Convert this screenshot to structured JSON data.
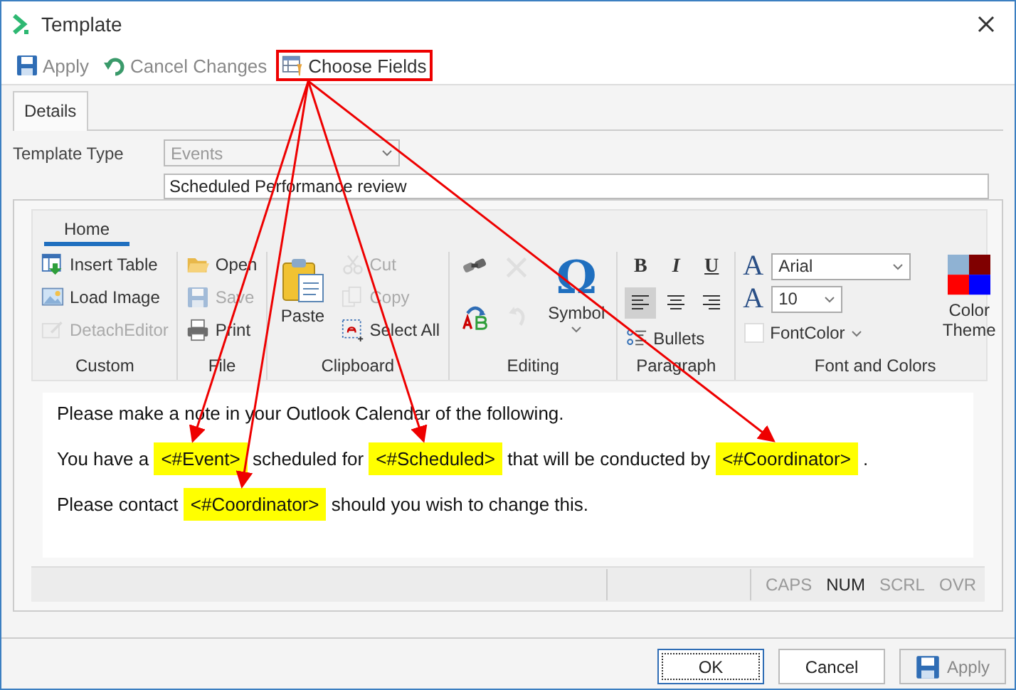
{
  "window": {
    "title": "Template"
  },
  "toolbar": [
    {
      "kind": "save",
      "label": "Apply",
      "disabled": true,
      "highlighted": false
    },
    {
      "kind": "undo",
      "label": "Cancel Changes",
      "disabled": true,
      "highlighted": false
    },
    {
      "kind": "fields",
      "label": "Choose Fields",
      "disabled": false,
      "highlighted": true
    }
  ],
  "tabs": [
    {
      "label": "Details",
      "selected": true
    }
  ],
  "form": {
    "template_type": {
      "label": "Template Type",
      "value": "Events",
      "disabled": true
    },
    "name": {
      "value": "Scheduled Performance review"
    }
  },
  "ribbon": {
    "tabs": [
      {
        "label": "Home",
        "selected": true
      }
    ],
    "groups": [
      {
        "label": "Custom",
        "items": [
          {
            "kind": "insert-table",
            "label": "Insert Table",
            "disabled": false
          },
          {
            "kind": "load-image",
            "label": "Load Image",
            "disabled": false
          },
          {
            "kind": "detach",
            "label": "DetachEditor",
            "disabled": true
          }
        ]
      },
      {
        "label": "File",
        "items": [
          {
            "kind": "open",
            "label": "Open",
            "disabled": false
          },
          {
            "kind": "save",
            "label": "Save",
            "disabled": true
          },
          {
            "kind": "print",
            "label": "Print",
            "disabled": false
          }
        ]
      },
      {
        "label": "Clipboard",
        "items": [
          {
            "kind": "paste",
            "label": "Paste",
            "disabled": false
          },
          {
            "kind": "cut",
            "label": "Cut",
            "disabled": true
          },
          {
            "kind": "copy",
            "label": "Copy",
            "disabled": true
          },
          {
            "kind": "select-all",
            "label": "Select All",
            "disabled": false
          }
        ]
      },
      {
        "label": "Editing",
        "items": [
          {
            "kind": "find",
            "disabled": false
          },
          {
            "kind": "delete",
            "disabled": true
          },
          {
            "kind": "replace",
            "disabled": false
          },
          {
            "kind": "redo",
            "disabled": true
          },
          {
            "kind": "symbol",
            "glyph": "Ω",
            "label": "Symbol",
            "disabled": false
          }
        ]
      },
      {
        "label": "Paragraph",
        "items": [
          {
            "kind": "bold",
            "label": "B",
            "selected": false
          },
          {
            "kind": "italic",
            "label": "I",
            "selected": false
          },
          {
            "kind": "underline",
            "label": "U",
            "selected": false
          },
          {
            "kind": "align-left",
            "selected": true
          },
          {
            "kind": "align-center",
            "selected": false
          },
          {
            "kind": "align-right",
            "selected": false
          },
          {
            "kind": "bullets",
            "label": "Bullets",
            "disabled": false
          }
        ]
      },
      {
        "label": "Font and Colors",
        "items": [
          {
            "kind": "font",
            "glyph": "A",
            "value": "Arial"
          },
          {
            "kind": "size",
            "glyph": "A",
            "value": "10"
          },
          {
            "kind": "font-color",
            "label": "FontColor",
            "color": "#ffffff"
          },
          {
            "kind": "color-theme",
            "label": "Color Theme"
          }
        ]
      }
    ]
  },
  "editor": {
    "paragraphs": [
      [
        {
          "kind": "text",
          "text": "Please make a note in your Outlook Calendar of the following."
        }
      ],
      [
        {
          "kind": "text",
          "text": "You have a "
        },
        {
          "kind": "field",
          "text": "<#Event>",
          "annotated": true
        },
        {
          "kind": "text",
          "text": " scheduled for "
        },
        {
          "kind": "field",
          "text": "<#Scheduled>",
          "annotated": true
        },
        {
          "kind": "text",
          "text": " that will be conducted by "
        },
        {
          "kind": "field",
          "text": "<#Coordinator>",
          "annotated": true
        },
        {
          "kind": "text",
          "text": " ."
        }
      ],
      [
        {
          "kind": "text",
          "text": "Please contact "
        },
        {
          "kind": "field",
          "text": "<#Coordinator>",
          "annotated": true
        },
        {
          "kind": "text",
          "text": " should you wish to change this."
        }
      ]
    ]
  },
  "status_bar": [
    {
      "label": "CAPS",
      "on": false
    },
    {
      "label": "NUM",
      "on": true
    },
    {
      "label": "SCRL",
      "on": false
    },
    {
      "label": "OVR",
      "on": false
    }
  ],
  "buttons": [
    {
      "kind": "ok",
      "label": "OK",
      "disabled": false
    },
    {
      "kind": "cancel",
      "label": "Cancel",
      "disabled": false
    },
    {
      "kind": "apply",
      "label": "Apply",
      "disabled": true
    }
  ]
}
